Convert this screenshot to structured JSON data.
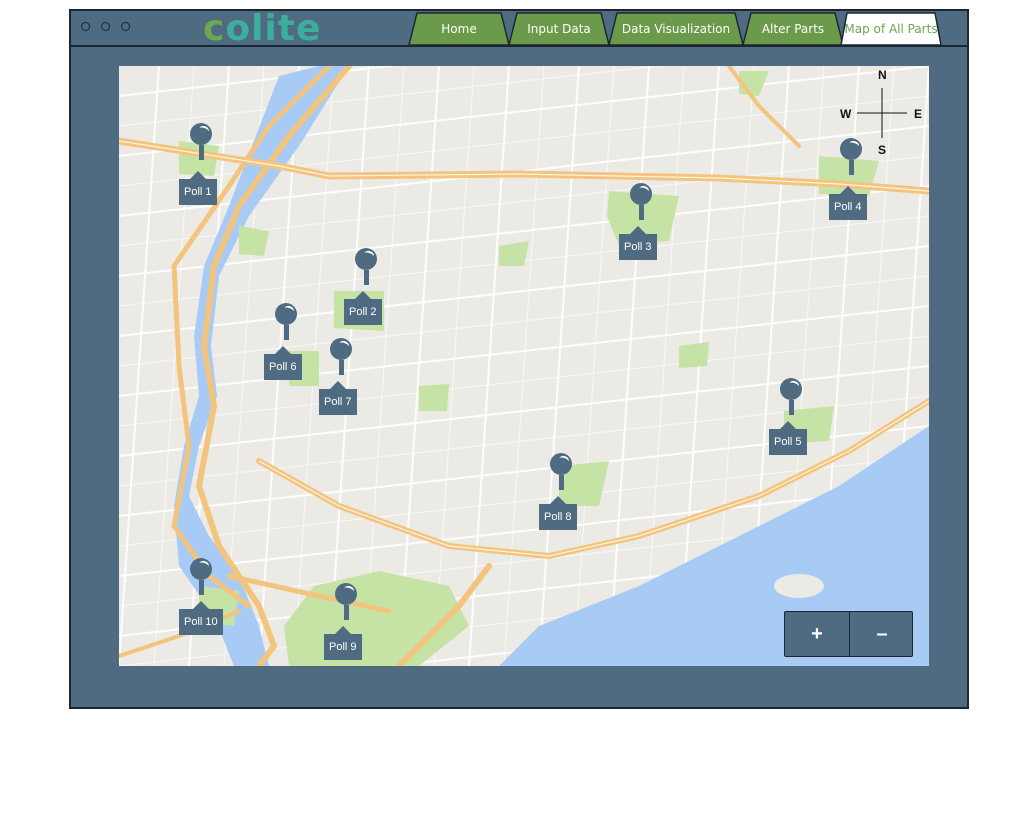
{
  "app": {
    "logo_first": "c",
    "logo_rest": "olite",
    "colors": {
      "frame": "#4f6b82",
      "tab_green": "#6a9a4a",
      "tab_active_bg": "#ffffff",
      "logo_green": "#6aa84f",
      "logo_teal": "#3cae9e",
      "water": "#a8cbf5",
      "park": "#c6e3a6",
      "highway": "#f3c47d"
    }
  },
  "window_controls": [
    "window-dot",
    "window-dot",
    "window-dot"
  ],
  "tabs": [
    {
      "label": "Home",
      "active": false
    },
    {
      "label": "Input Data",
      "active": false
    },
    {
      "label": "Data Visualization",
      "active": false
    },
    {
      "label": "Alter Parts",
      "active": false
    },
    {
      "label": "Map of All Parts",
      "active": true
    }
  ],
  "compass": {
    "n": "N",
    "e": "E",
    "s": "S",
    "w": "W"
  },
  "polls": [
    {
      "label": "Poll 1"
    },
    {
      "label": "Poll 2"
    },
    {
      "label": "Poll 3"
    },
    {
      "label": "Poll 4"
    },
    {
      "label": "Poll 5"
    },
    {
      "label": "Poll 6"
    },
    {
      "label": "Poll 7"
    },
    {
      "label": "Poll 8"
    },
    {
      "label": "Poll 9"
    },
    {
      "label": "Poll 10"
    }
  ],
  "zoom": {
    "in_label": "+",
    "out_label": "–"
  }
}
